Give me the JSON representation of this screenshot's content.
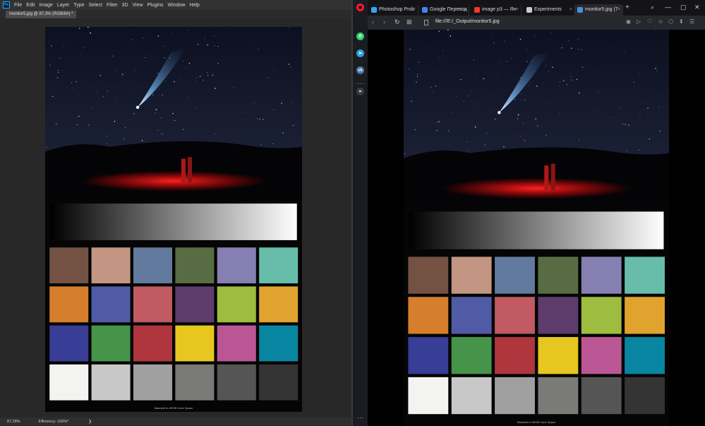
{
  "photoshop": {
    "menu": [
      "File",
      "Edit",
      "Image",
      "Layer",
      "Type",
      "Select",
      "Filter",
      "3D",
      "View",
      "Plugins",
      "Window",
      "Help"
    ],
    "logo_text": "Ps",
    "doc_tab": "monitor5.jpg @ 87,3% (RGB/8#) *",
    "status_zoom": "87,28%",
    "status_efficiency": "Efficiency: 100%*",
    "status_arrow": "❯"
  },
  "opera": {
    "tabs": [
      {
        "label": "Photoshop Prob",
        "fav_color": "#31a8ff",
        "active": false
      },
      {
        "label": "Google Перевод",
        "fav_color": "#4285f4",
        "active": false
      },
      {
        "label": "image p3 — Ян",
        "fav_color": "#ff3333",
        "active": false
      },
      {
        "label": "Experiments",
        "fav_color": "#cccccc",
        "active": false
      },
      {
        "label": "monitor5.jpg (7",
        "fav_color": "#4a90d9",
        "active": true
      }
    ],
    "new_tab_label": "+",
    "url": "file:///E:/_Output/monitor5.jpg",
    "win_controls": [
      "⌕",
      "—",
      "▢",
      "✕"
    ],
    "nav_icons": [
      "‹",
      "›",
      "↻",
      "⊞"
    ],
    "right_icons": [
      "◉",
      "▷",
      "♡",
      "☺",
      "⬡",
      "⬇",
      "☰"
    ],
    "sidebar_icons": [
      {
        "name": "whatsapp-icon",
        "glyph": "✆",
        "color": "#25d366"
      },
      {
        "name": "telegram-icon",
        "glyph": "➤",
        "color": "#2aa3dd"
      },
      {
        "name": "vk-icon",
        "glyph": "vk",
        "color": "#4a76a8"
      },
      {
        "name": "send-icon",
        "glyph": "➢",
        "color": "#3a3b42"
      }
    ],
    "sidebar_more": "⋯"
  },
  "image": {
    "caption": "Macbeth in sRGB Color Space",
    "patches": [
      [
        "#735244",
        "#c29682",
        "#627a9d",
        "#576c43",
        "#8580b1",
        "#67bdaa"
      ],
      [
        "#d67e2c",
        "#505ba6",
        "#c15a63",
        "#5e3c6c",
        "#9dbc40",
        "#e0a32e"
      ],
      [
        "#383d96",
        "#469449",
        "#af363c",
        "#e7c71f",
        "#bb5695",
        "#0885a1"
      ],
      [
        "#f3f3f2",
        "#c8c8c8",
        "#a0a0a0",
        "#7a7a79",
        "#555555",
        "#343434"
      ]
    ]
  }
}
